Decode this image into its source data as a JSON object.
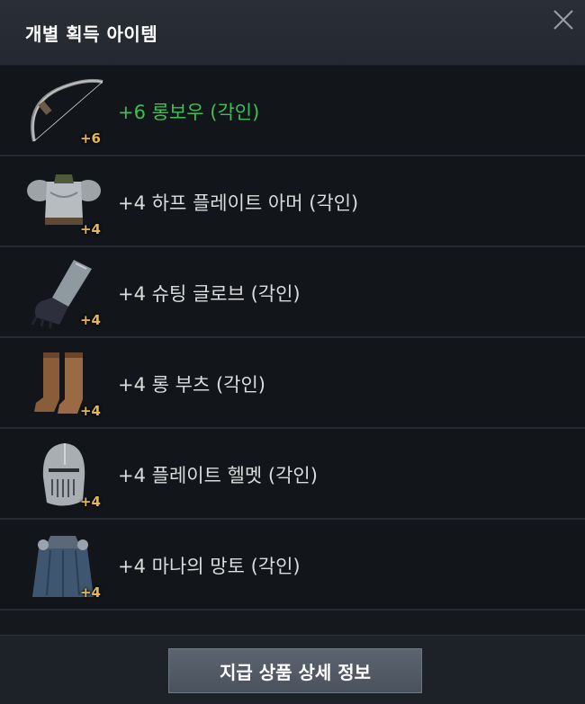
{
  "header": {
    "title": "개별 획득 아이템"
  },
  "items": [
    {
      "name": "+6 롱보우 (각인)",
      "badge": "+6",
      "icon": "longbow-icon",
      "color": "#3fbf55"
    },
    {
      "name": "+4 하프 플레이트 아머 (각인)",
      "badge": "+4",
      "icon": "plate-armor-icon"
    },
    {
      "name": "+4 슈팅 글로브 (각인)",
      "badge": "+4",
      "icon": "glove-icon"
    },
    {
      "name": "+4 롱 부츠 (각인)",
      "badge": "+4",
      "icon": "boots-icon"
    },
    {
      "name": "+4 플레이트 헬멧 (각인)",
      "badge": "+4",
      "icon": "helmet-icon"
    },
    {
      "name": "+4 마나의 망토 (각인)",
      "badge": "+4",
      "icon": "cloak-icon"
    }
  ],
  "footer": {
    "button_label": "지급 상품 상세 정보"
  }
}
